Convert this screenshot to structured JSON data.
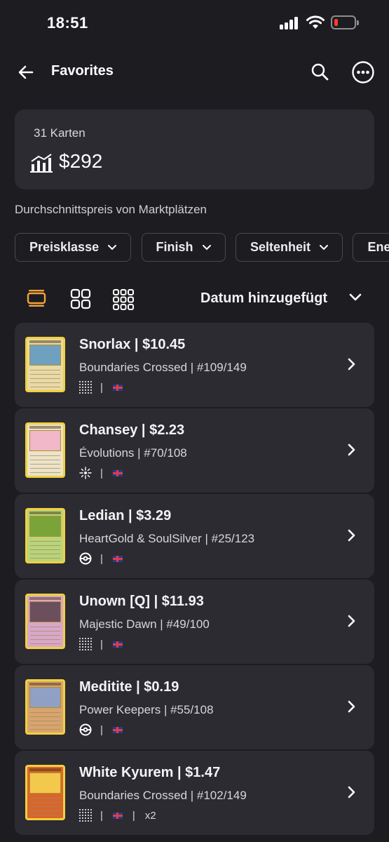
{
  "status": {
    "time": "18:51"
  },
  "nav": {
    "title": "Favorites"
  },
  "summary": {
    "count_label": "31 Karten",
    "total": "$292"
  },
  "price_note": "Durchschnittspreis von Marktplätzen",
  "filters": [
    {
      "label": "Preisklasse"
    },
    {
      "label": "Finish"
    },
    {
      "label": "Seltenheit"
    },
    {
      "label": "Energ"
    }
  ],
  "sort": {
    "label": "Datum hinzugefügt"
  },
  "colors": {
    "accent": "#f2a33a",
    "background": "#1d1c21",
    "card": "#2c2b32"
  },
  "cards": [
    {
      "title": "Snorlax | $10.45",
      "subtitle": "Boundaries Crossed | #109/149",
      "finish_icon": "dots-grid-icon",
      "flag": "uk-flag-icon",
      "qty": "",
      "thumb_color": "#e9d9a6",
      "art_color": "#6fa0c0"
    },
    {
      "title": "Chansey | $2.23",
      "subtitle": "Évolutions | #70/108",
      "finish_icon": "sparkle-icon",
      "flag": "uk-flag-icon",
      "qty": "",
      "thumb_color": "#ece3c8",
      "art_color": "#f0b8c8"
    },
    {
      "title": "Ledian | $3.29",
      "subtitle": "HeartGold & SoulSilver | #25/123",
      "finish_icon": "pokeball-icon",
      "flag": "uk-flag-icon",
      "qty": "",
      "thumb_color": "#b9d47a",
      "art_color": "#7aa43a"
    },
    {
      "title": "Unown [Q] | $11.93",
      "subtitle": "Majestic Dawn | #49/100",
      "finish_icon": "dots-grid-icon",
      "flag": "uk-flag-icon",
      "qty": "",
      "thumb_color": "#d9a7c9",
      "art_color": "#6c4f5c"
    },
    {
      "title": "Meditite | $0.19",
      "subtitle": "Power Keepers | #55/108",
      "finish_icon": "pokeball-icon",
      "flag": "uk-flag-icon",
      "qty": "",
      "thumb_color": "#d9a46e",
      "art_color": "#8fa0c4"
    },
    {
      "title": "White Kyurem | $1.47",
      "subtitle": "Boundaries Crossed | #102/149",
      "finish_icon": "dots-grid-icon",
      "flag": "uk-flag-icon",
      "qty": "x2",
      "thumb_color": "#d8662c",
      "art_color": "#f2c94c"
    }
  ]
}
